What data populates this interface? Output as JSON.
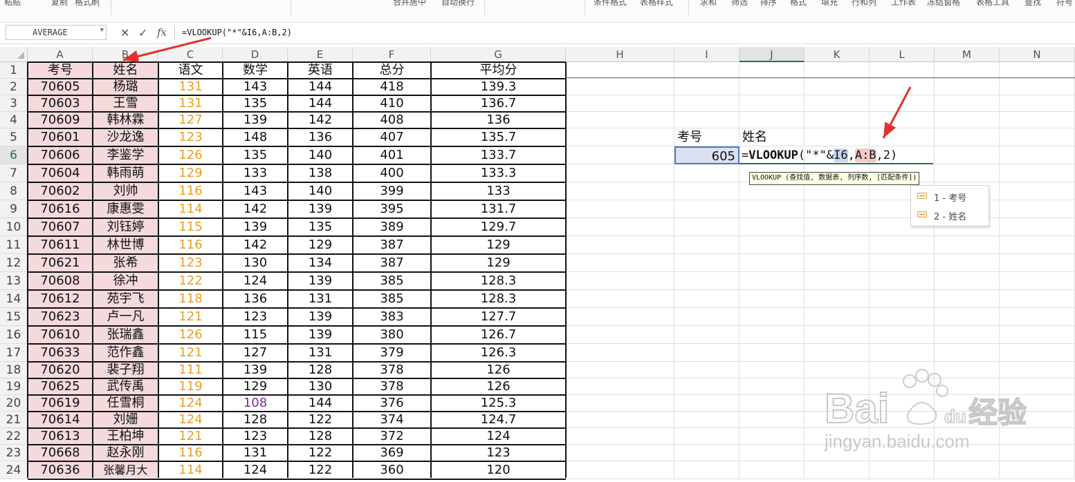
{
  "ribbon": {
    "items": [
      "粘贴",
      "复制",
      "格式刷",
      "合并居中",
      "自动换行",
      "条件格式",
      "表格样式",
      "求和",
      "筛选",
      "排序",
      "格式",
      "填充",
      "行和列",
      "工作表",
      "冻结窗格",
      "表格工具",
      "查找",
      "符号"
    ]
  },
  "formula_bar": {
    "name_box": "AVERAGE",
    "cancel_icon": "✕",
    "confirm_icon": "✓",
    "fx_label": "fx",
    "formula": "=VLOOKUP(\"*\"&I6,A:B,2)"
  },
  "columns": [
    "A",
    "B",
    "C",
    "D",
    "E",
    "F",
    "G",
    "H",
    "I",
    "J",
    "K",
    "L",
    "M",
    "N"
  ],
  "rows": [
    "1",
    "2",
    "3",
    "4",
    "5",
    "6",
    "7",
    "8",
    "9",
    "10",
    "11",
    "12",
    "13",
    "14",
    "15",
    "16",
    "17",
    "18",
    "19",
    "20",
    "21",
    "22",
    "23",
    "24"
  ],
  "table": {
    "headers": [
      "考号",
      "姓名",
      "语文",
      "数学",
      "英语",
      "总分",
      "平均分"
    ],
    "rows": [
      [
        "70605",
        "杨璐",
        "131",
        "143",
        "144",
        "418",
        "139.3"
      ],
      [
        "70603",
        "王雪",
        "131",
        "135",
        "144",
        "410",
        "136.7"
      ],
      [
        "70609",
        "韩林霖",
        "127",
        "139",
        "142",
        "408",
        "136"
      ],
      [
        "70601",
        "沙龙逸",
        "123",
        "148",
        "136",
        "407",
        "135.7"
      ],
      [
        "70606",
        "李鉴学",
        "126",
        "135",
        "140",
        "401",
        "133.7"
      ],
      [
        "70604",
        "韩雨萌",
        "129",
        "133",
        "138",
        "400",
        "133.3"
      ],
      [
        "70602",
        "刘帅",
        "116",
        "143",
        "140",
        "399",
        "133"
      ],
      [
        "70616",
        "康惠雯",
        "114",
        "142",
        "139",
        "395",
        "131.7"
      ],
      [
        "70607",
        "刘钰婷",
        "115",
        "139",
        "135",
        "389",
        "129.7"
      ],
      [
        "70611",
        "林世博",
        "116",
        "142",
        "129",
        "387",
        "129"
      ],
      [
        "70621",
        "张希",
        "123",
        "130",
        "134",
        "387",
        "129"
      ],
      [
        "70608",
        "徐冲",
        "122",
        "124",
        "139",
        "385",
        "128.3"
      ],
      [
        "70612",
        "苑宇飞",
        "118",
        "136",
        "131",
        "385",
        "128.3"
      ],
      [
        "70623",
        "卢一凡",
        "121",
        "123",
        "139",
        "383",
        "127.7"
      ],
      [
        "70610",
        "张瑞鑫",
        "126",
        "115",
        "139",
        "380",
        "126.7"
      ],
      [
        "70633",
        "范作鑫",
        "121",
        "127",
        "131",
        "379",
        "126.3"
      ],
      [
        "70620",
        "裴子翔",
        "111",
        "139",
        "128",
        "378",
        "126"
      ],
      [
        "70625",
        "武传禹",
        "119",
        "129",
        "130",
        "378",
        "126"
      ],
      [
        "70619",
        "任雪桐",
        "124",
        "108",
        "144",
        "376",
        "125.3"
      ],
      [
        "70614",
        "刘姗",
        "124",
        "128",
        "122",
        "374",
        "124.7"
      ],
      [
        "70613",
        "王柏坤",
        "121",
        "123",
        "128",
        "372",
        "124"
      ],
      [
        "70668",
        "赵永刚",
        "116",
        "131",
        "122",
        "369",
        "123"
      ],
      [
        "70636",
        "张馨月大",
        "114",
        "124",
        "122",
        "360",
        "120"
      ]
    ]
  },
  "lookup": {
    "label_id": "考号",
    "label_name": "姓名",
    "input_value": "605",
    "formula_parts": [
      "=",
      "VLOOKUP",
      "(\"*\"&",
      "I6",
      ",",
      "A:B",
      ",",
      "2",
      ")"
    ]
  },
  "tooltip": "VLOOKUP (查找值, 数据表, 列序数, [匹配条件])",
  "autocomplete": [
    {
      "label": "1 - 考号"
    },
    {
      "label": "2 - 姓名"
    }
  ],
  "watermark": {
    "brand": "Bai",
    "brand2": "du",
    "cn": "经验",
    "url": "jingyan.baidu.com"
  },
  "colors": {
    "header_selected": "#217346",
    "chinese_score": "#e8a020",
    "math_low": "#7b2b8a",
    "key_fill": "#f4dada",
    "arrow": "#e03030",
    "ref_i6": "#c9d6f0",
    "ref_ab": "#f2c8c8",
    "cell_sel": "#d9e1f2"
  }
}
